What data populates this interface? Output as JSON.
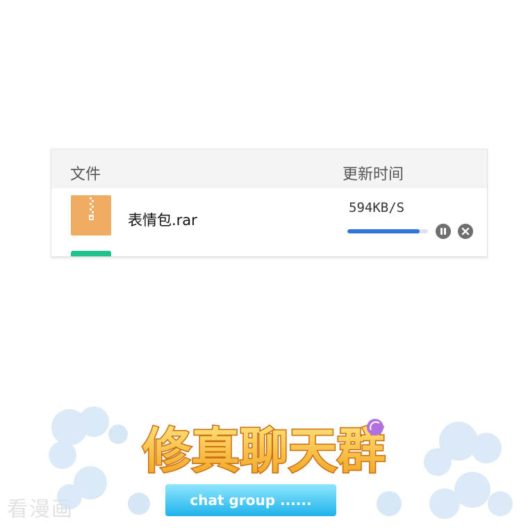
{
  "table": {
    "headers": {
      "file": "文件",
      "time": "更新时间"
    },
    "rows": [
      {
        "icon": "zip-archive-icon",
        "icon_color": "#f0ac63",
        "file_name": "表情包.rar",
        "speed": "594KB/S",
        "progress": 0.9,
        "progress_color": "#2f74d6"
      }
    ],
    "next_row_icon_color": "#20c28c"
  },
  "controls": {
    "pause_icon": "pause-icon",
    "cancel_icon": "close-icon"
  },
  "watermark": {
    "text": "看漫画"
  },
  "logo": {
    "title": "修真聊天群",
    "subtitle": "chat group ......"
  }
}
